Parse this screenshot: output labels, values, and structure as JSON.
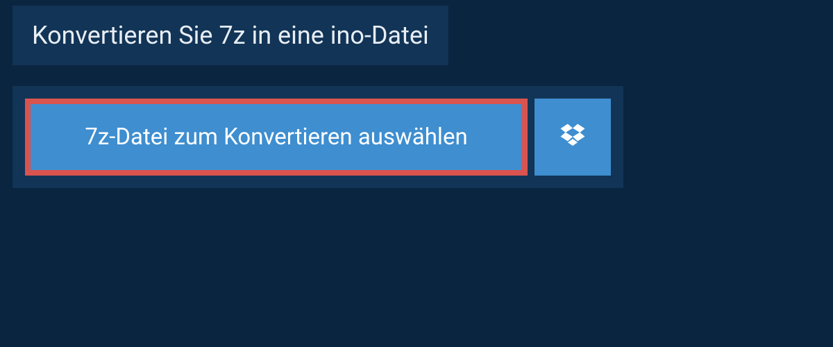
{
  "header": {
    "title": "Konvertieren Sie 7z in eine ino-Datei"
  },
  "upload": {
    "select_button_label": "7z-Datei zum Konvertieren auswählen",
    "dropbox_icon": "dropbox-icon"
  },
  "colors": {
    "background": "#0a2540",
    "panel": "#123456",
    "button": "#3e8ed0",
    "highlight_border": "#d9534f",
    "text": "#e8eef5"
  }
}
